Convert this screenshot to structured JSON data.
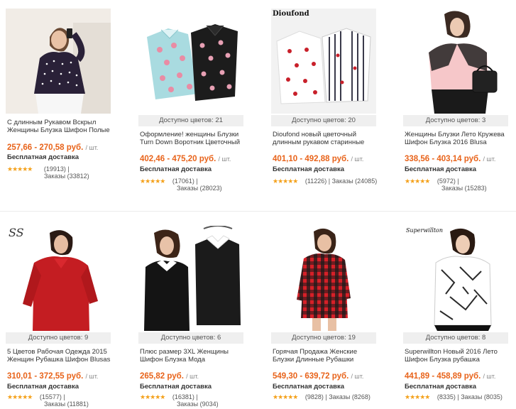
{
  "colors": {
    "price": "#e8631a",
    "stars": "#f4a11b",
    "avail_bg": "#efefef"
  },
  "products": [
    {
      "image_label": "woman-black-polka-dot-blouse",
      "availability": "",
      "title_line1": "С длинным Рукавом Вскрыл",
      "title_line2": "Женщины Блузка Шифон Полые",
      "price": "257,66 - 270,58 руб.",
      "unit": "/ шт.",
      "shipping": "Бесплатная доставка",
      "stars": "★★★★★",
      "reviews": "(19913)",
      "divider": "|",
      "orders": "Заказы (33812)"
    },
    {
      "image_label": "floral-shirts-blue-and-black",
      "availability": "Доступно цветов: 21",
      "title_line1": "Оформление! женщины Блузки",
      "title_line2": "Turn Down Воротник Цветочный",
      "price": "402,46 - 475,20 руб.",
      "unit": "/ шт.",
      "shipping": "Бесплатная доставка",
      "stars": "★★★★★",
      "reviews": "(17061)",
      "divider": "|",
      "orders": "Заказы (28023)"
    },
    {
      "image_label": "dioufond-cherry-and-striped-shirts",
      "image_brand": "Dioufond",
      "availability": "Доступно цветов: 20",
      "title_line1": "Dioufond новый цветочный",
      "title_line2": "длинным рукавом старинные",
      "price": "401,10 - 492,88 руб.",
      "unit": "/ шт.",
      "shipping": "Бесплатная доставка",
      "stars": "★★★★★",
      "reviews": "(11226)",
      "divider": "|",
      "orders": "Заказы (24085)"
    },
    {
      "image_label": "woman-pink-lace-blouse",
      "availability": "Доступно цветов: 3",
      "title_line1": "Женщины Блузки Лето Кружева",
      "title_line2": "Шифон Блузка 2016 Blusa",
      "price": "338,56 - 403,14 руб.",
      "unit": "/ шт.",
      "shipping": "Бесплатная доставка",
      "stars": "★★★★★",
      "reviews": "(5972)",
      "divider": "|",
      "orders": "Заказы (15283)"
    },
    {
      "image_label": "woman-red-work-shirt",
      "image_brand": "SS",
      "availability": "Доступно цветов: 9",
      "title_line1": "5 Цветов Рабочая Одежда 2015",
      "title_line2": "Женщин Рубашка Шифон Blusas",
      "price": "310,01 - 372,55 руб.",
      "unit": "/ шт.",
      "shipping": "Бесплатная доставка",
      "stars": "★★★★★",
      "reviews": "(15577)",
      "divider": "|",
      "orders": "Заказы (11881)"
    },
    {
      "image_label": "woman-black-blouse-white-collar",
      "availability": "Доступно цветов: 6",
      "title_line1": "Плюс размер 3XL Женщины",
      "title_line2": "Шифон Блузка Мода",
      "price": "265,82 руб.",
      "unit": "/ шт.",
      "shipping": "Бесплатная доставка",
      "stars": "★★★★★",
      "reviews": "(16381)",
      "divider": "|",
      "orders": "Заказы (9034)"
    },
    {
      "image_label": "woman-red-plaid-shirt",
      "availability": "Доступно цветов: 19",
      "title_line1": "Горячая Продажа Женские",
      "title_line2": "Блузки Длинные Рубашки",
      "price": "549,30 - 639,72 руб.",
      "unit": "/ шт.",
      "shipping": "Бесплатная доставка",
      "stars": "★★★★★",
      "reviews": "(9828)",
      "divider": "|",
      "orders": "Заказы (8268)"
    },
    {
      "image_label": "woman-white-geometric-blouse",
      "image_brand": "Superwillton",
      "availability": "Доступно цветов: 8",
      "title_line1": "Superwillton Новый 2016 Лето",
      "title_line2": "Шифон Блузка рубашка",
      "price": "441,89 - 458,89 руб.",
      "unit": "/ шт.",
      "shipping": "Бесплатная доставка",
      "stars": "★★★★★",
      "reviews": "(8335)",
      "divider": "|",
      "orders": "Заказы (8035)"
    }
  ]
}
